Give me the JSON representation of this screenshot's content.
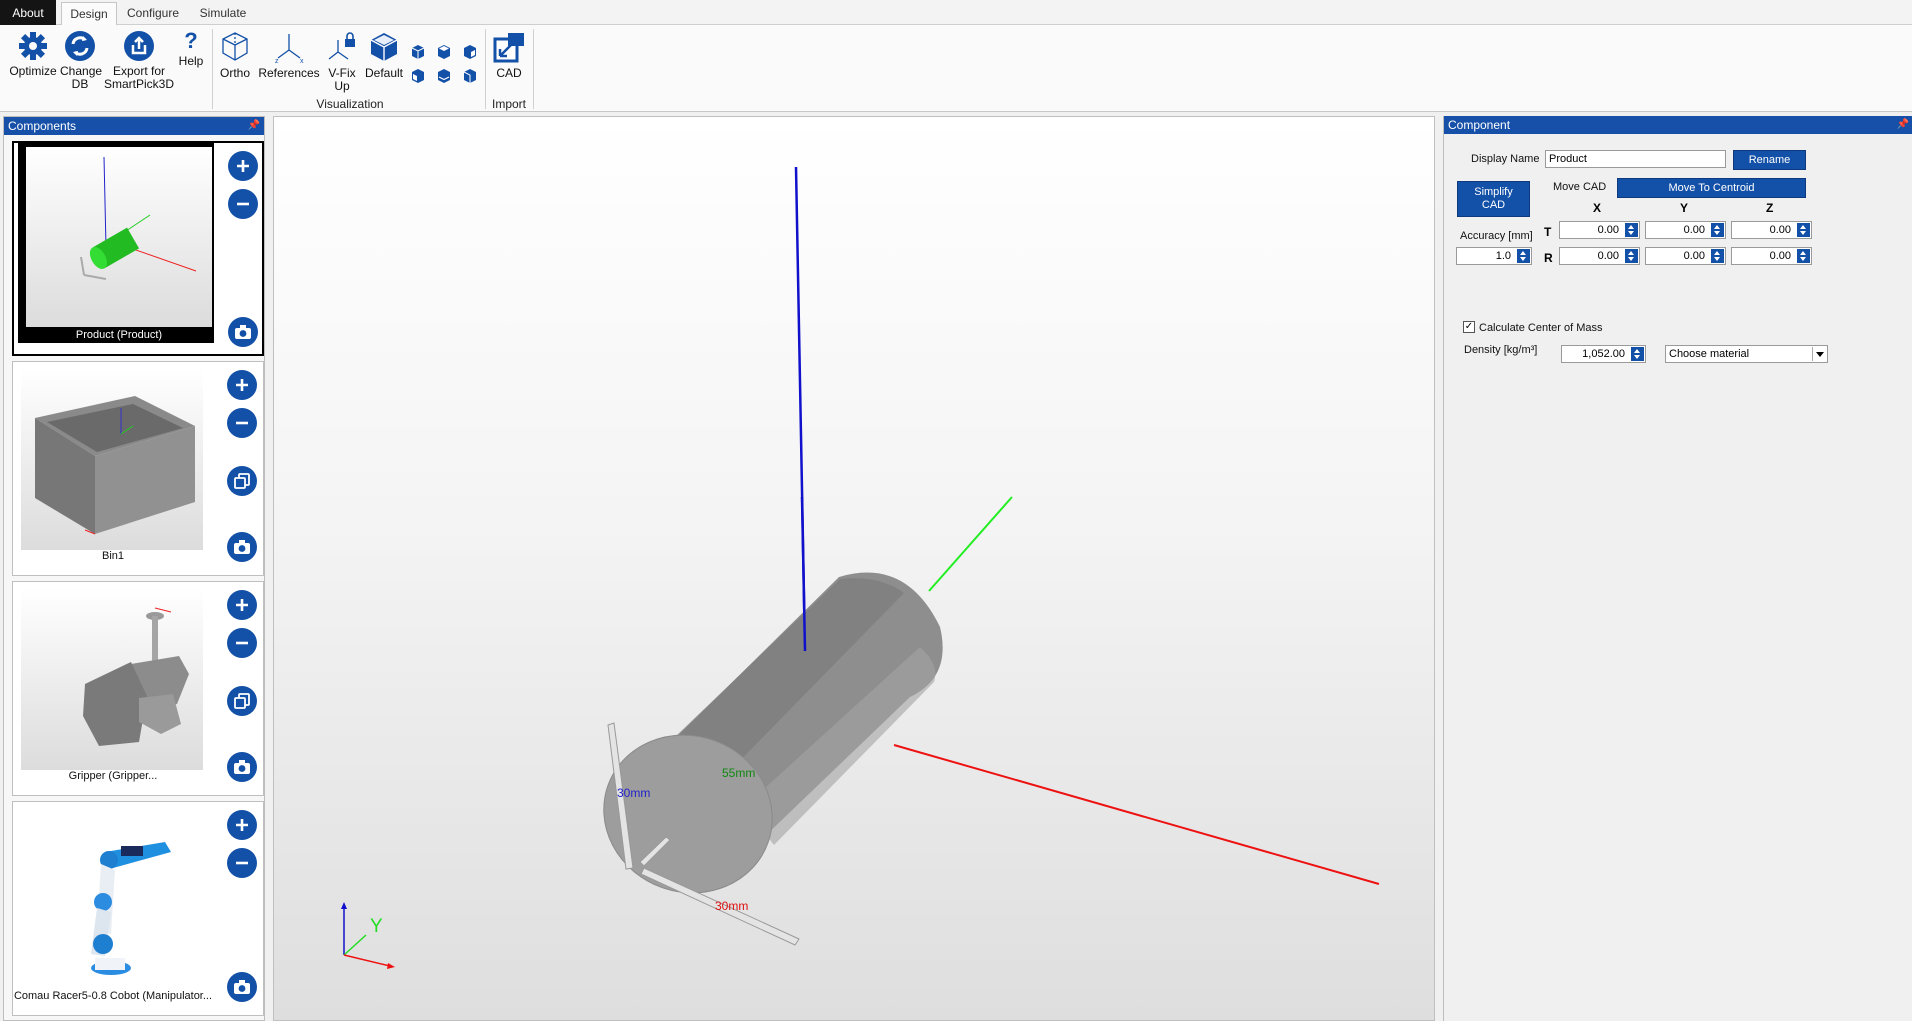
{
  "tabs": [
    {
      "label": "About"
    },
    {
      "label": "Design"
    },
    {
      "label": "Configure"
    },
    {
      "label": "Simulate"
    }
  ],
  "ribbon": {
    "optimize": "Optimize",
    "change_db": [
      "Change",
      "DB"
    ],
    "export": [
      "Export for",
      "SmartPick3D"
    ],
    "help": "Help",
    "ortho": "Ortho",
    "references": "References",
    "vfix": [
      "V-Fix",
      "Up"
    ],
    "default": "Default",
    "cad": "CAD",
    "group_visualization": "Visualization",
    "group_import": "Import"
  },
  "components_panel": {
    "title": "Components",
    "items": [
      {
        "caption": "Product (Product)"
      },
      {
        "caption": "Bin1"
      },
      {
        "caption": "Gripper (Gripper..."
      },
      {
        "caption": "Comau Racer5-0.8 Cobot (Manipulator..."
      }
    ]
  },
  "viewport": {
    "dimension_labels": [
      "30mm",
      "55mm",
      "30mm"
    ],
    "triad_y": "Y"
  },
  "component_panel": {
    "title": "Component",
    "display_name_label": "Display Name",
    "display_name_value": "Product",
    "rename_button": "Rename",
    "simplify_button": [
      "Simplify",
      "CAD"
    ],
    "move_cad_label": "Move CAD",
    "move_centroid_button": "Move To Centroid",
    "axis_headers": [
      "X",
      "Y",
      "Z"
    ],
    "row_labels": [
      "T",
      "R"
    ],
    "accuracy_label": "Accuracy [mm]",
    "accuracy_value": "1.0",
    "translation": [
      "0.00",
      "0.00",
      "0.00"
    ],
    "rotation": [
      "0.00",
      "0.00",
      "0.00"
    ],
    "calc_com_label": "Calculate Center of Mass",
    "calc_com_checked": true,
    "density_label": "Density [kg/m³]",
    "density_value": "1,052.00",
    "material_select": "Choose material"
  },
  "colors": {
    "accent": "#1350a7",
    "panel_header": "#1750a8",
    "axis_x": "#ee1111",
    "axis_y": "#22dd22",
    "axis_z": "#1111cc"
  }
}
